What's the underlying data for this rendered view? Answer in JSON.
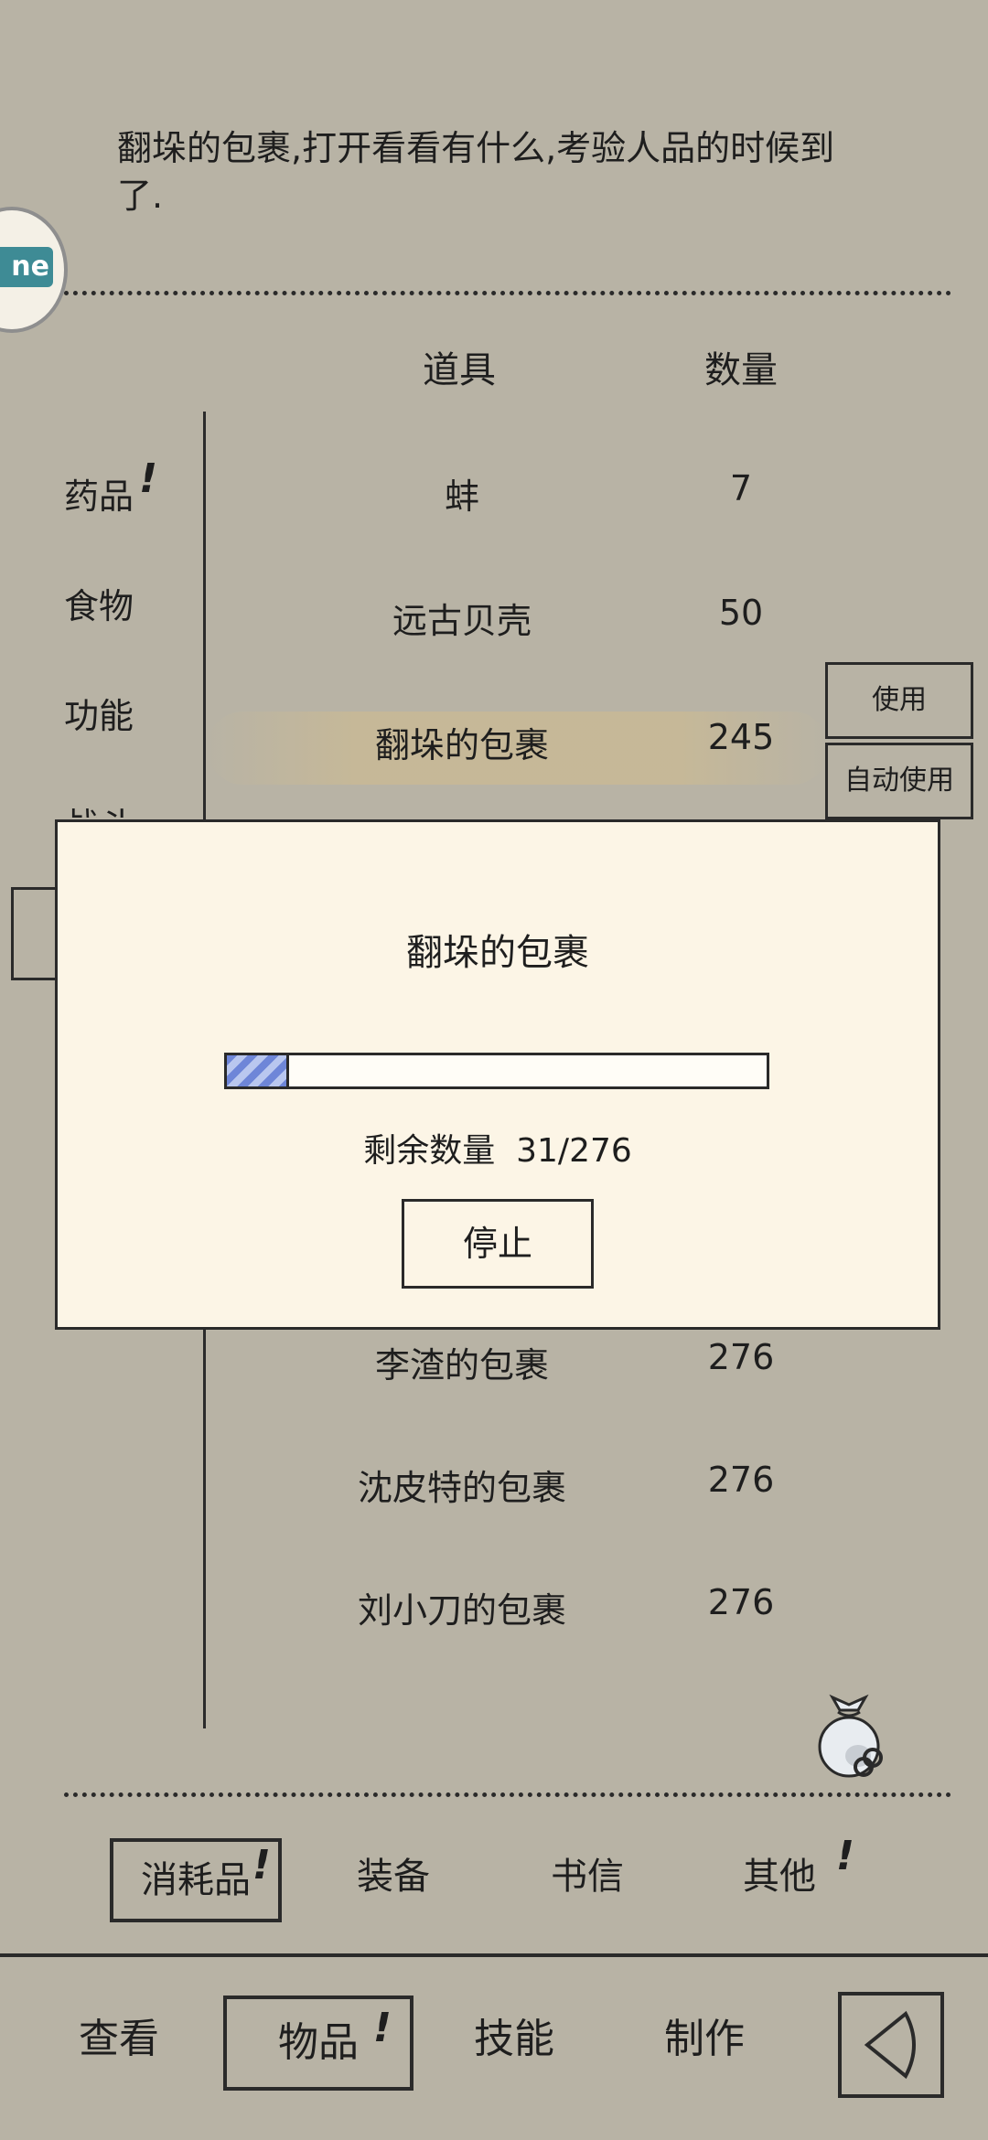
{
  "description": "翻垛的包裹,打开看看有什么,考验人品的时候到了.",
  "avatar_label": "ne",
  "table_headers": {
    "item": "道具",
    "qty": "数量"
  },
  "categories": [
    {
      "label": "药品",
      "badge": "!"
    },
    {
      "label": "食物"
    },
    {
      "label": "功能"
    },
    {
      "label": "战斗"
    }
  ],
  "items_top": [
    {
      "name": "蚌",
      "qty": "7"
    },
    {
      "name": "远古贝壳",
      "qty": "50"
    },
    {
      "name": "翻垛的包裹",
      "qty": "245"
    }
  ],
  "items_bottom": [
    {
      "name": "李渣的包裹",
      "qty": "276"
    },
    {
      "name": "沈皮特的包裹",
      "qty": "276"
    },
    {
      "name": "刘小刀的包裹",
      "qty": "276"
    }
  ],
  "side_buttons": {
    "use": "使用",
    "auto_use": "自动使用"
  },
  "modal": {
    "title": "翻垛的包裹",
    "progress_fraction": 0.11,
    "remain_label": "剩余数量",
    "remain_value": "31/276",
    "stop_label": "停止"
  },
  "tabs": [
    {
      "label": "消耗品",
      "badge": "!",
      "active": true
    },
    {
      "label": "装备"
    },
    {
      "label": "书信"
    },
    {
      "label": "其他",
      "badge": "!"
    }
  ],
  "nav": [
    {
      "label": "查看"
    },
    {
      "label": "物品",
      "badge": "!",
      "active": true
    },
    {
      "label": "技能"
    },
    {
      "label": "制作"
    }
  ],
  "icons": {
    "bag": "bag-icon",
    "back": "back-arrow-icon"
  },
  "colors": {
    "background": "#b8b3a5",
    "modal_bg": "#fcf5e6",
    "progress": "#6e86d8",
    "avatar_tag": "#3e8b95"
  }
}
